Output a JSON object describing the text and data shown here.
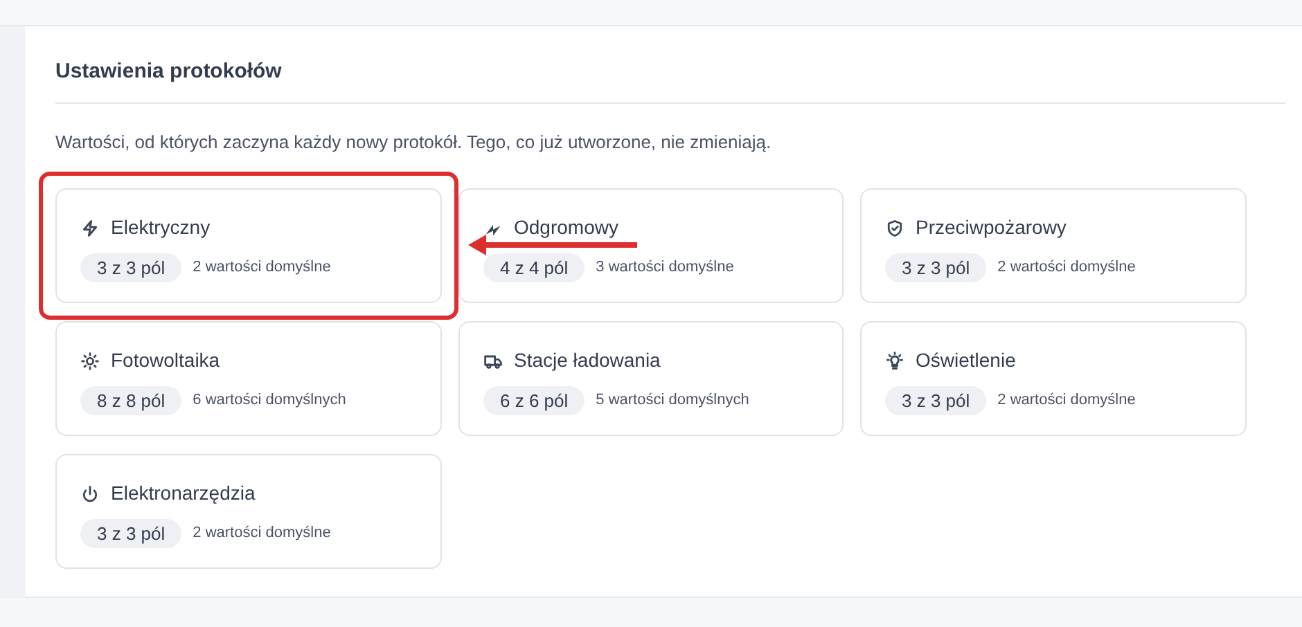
{
  "section": {
    "title": "Ustawienia protokołów",
    "description": "Wartości, od których zaczyna każdy nowy protokół. Tego, co już utworzone, nie zmieniają."
  },
  "cards": [
    {
      "kind": "bolt",
      "title": "Elektryczny",
      "fields": "3 z 3 pól",
      "defaults": "2 wartości domyślne",
      "highlighted": true
    },
    {
      "kind": "lightning",
      "title": "Odgromowy",
      "fields": "4 z 4 pól",
      "defaults": "3 wartości domyślne",
      "highlighted": false
    },
    {
      "kind": "shield",
      "title": "Przeciwpożarowy",
      "fields": "3 z 3 pól",
      "defaults": "2 wartości domyślne",
      "highlighted": false
    },
    {
      "kind": "sun",
      "title": "Fotowoltaika",
      "fields": "8 z 8 pól",
      "defaults": "6 wartości domyślnych",
      "highlighted": false
    },
    {
      "kind": "truck",
      "title": "Stacje ładowania",
      "fields": "6 z 6 pól",
      "defaults": "5 wartości domyślnych",
      "highlighted": false
    },
    {
      "kind": "bulb",
      "title": "Oświetlenie",
      "fields": "3 z 3 pól",
      "defaults": "2 wartości domyślne",
      "highlighted": false
    },
    {
      "kind": "power",
      "title": "Elektronarzędzia",
      "fields": "3 z 3 pól",
      "defaults": "2 wartości domyślne",
      "highlighted": false
    }
  ]
}
